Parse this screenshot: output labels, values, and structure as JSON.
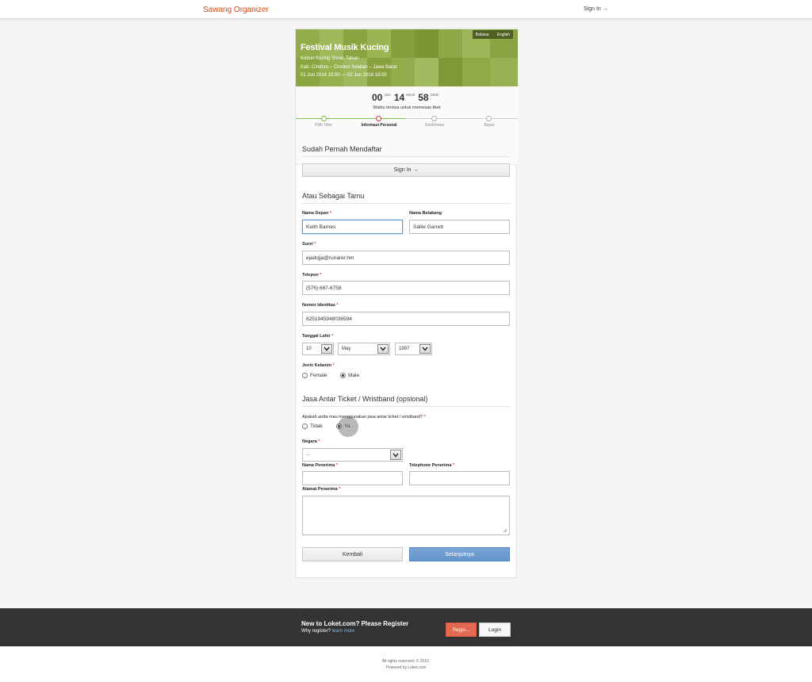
{
  "topbar": {
    "brand": "Sawang Organizer",
    "sign_in": "Sign In →"
  },
  "event": {
    "title": "Festival Musik Kucing",
    "venue": "Kebun Kucing Show, Tahun",
    "location": "Kab. Cirebon – Cirebon Selatan – Jawa Barat",
    "dates": "01 Jun 2016 15:00 — 02 Jun 2016 15:00"
  },
  "language": {
    "label": "Bahasa",
    "value": "English"
  },
  "timer": {
    "hours": "00",
    "hours_unit": "Jam",
    "minutes": "14",
    "minutes_unit": "Menit",
    "seconds": "58",
    "seconds_unit": "Detik",
    "label": "Waktu tersisa untuk memesan tiket"
  },
  "steps": [
    {
      "label": "Pilih Tiket",
      "state": "done"
    },
    {
      "label": "Informasi Personal",
      "state": "active"
    },
    {
      "label": "Konfirmasi",
      "state": "pending"
    },
    {
      "label": "Bayar",
      "state": "pending"
    }
  ],
  "registered": {
    "title": "Sudah Pernah Mendaftar",
    "button": "Sign In →"
  },
  "guest": {
    "title": "Atau Sebagai Tamu",
    "first_name_label": "Nama Depan",
    "first_name": "Keith Barnes",
    "last_name_label": "Nama Belakang",
    "last_name": "Sallie Garrett",
    "email_label": "Surel",
    "email": "ejadojja@runarer.hm",
    "phone_label": "Telepon",
    "phone": "(576) 687-6758",
    "id_label": "Nomor Identitas",
    "id_number": "6251945948036594",
    "birth_label": "Tanggal Lahir",
    "birth_day": "10",
    "birth_month": "May",
    "birth_year": "1997",
    "gender_label": "Jenis Kelamin",
    "gender_female": "Female",
    "gender_male": "Male"
  },
  "delivery": {
    "title": "Jasa Antar Ticket / Wristband (opsional)",
    "question": "Apakah anda mau menggunakan jasa antar ticket / wristband?",
    "no": "Tidak",
    "yes": "Ya",
    "country_label": "Negara",
    "country_value": "...",
    "recipient_name_label": "Nama Penerima",
    "recipient_phone_label": "Telephone Penerima",
    "recipient_address_label": "Alamat Penerima"
  },
  "actions": {
    "back": "Kembali",
    "next": "Selanjutnya"
  },
  "footer": {
    "title": "New to Loket.com? Please Register",
    "why": "Why register?",
    "learn": "learn more",
    "register": "Regis...",
    "login": "Login"
  },
  "bottom": {
    "rights": "All rights reserved. © 2016.",
    "powered": "Powered by Loket.com"
  },
  "colors": {
    "accent": "#8ba640",
    "brand": "#d9480f",
    "primary": "#6a98cf",
    "danger": "#e26a52"
  }
}
